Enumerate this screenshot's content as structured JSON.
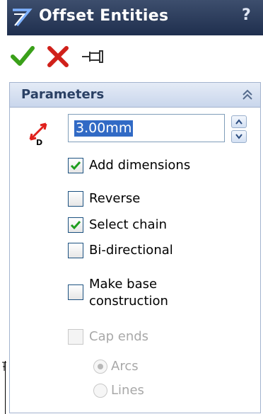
{
  "window": {
    "title": "Offset Entities",
    "help_label": "?",
    "title_icon": "offset-entities-icon"
  },
  "actions": {
    "ok": "checkmark-icon",
    "cancel": "red-x-icon",
    "pin": "push-pin-icon"
  },
  "parameters": {
    "title": "Parameters",
    "collapse_icon": "double-chevron-up-icon",
    "offset_distance": "3.00mm",
    "add_dimensions": {
      "label": "Add dimensions",
      "checked": true
    },
    "reverse": {
      "label": "Reverse",
      "checked": false
    },
    "select_chain": {
      "label": "Select chain",
      "checked": true
    },
    "bi_directional": {
      "label": "Bi-directional",
      "checked": false
    },
    "make_base_construction": {
      "label_line1": "Make base",
      "label_line2": "construction",
      "checked": false
    },
    "cap_ends": {
      "label": "Cap ends",
      "checked": false,
      "enabled": false
    },
    "cap_options": [
      {
        "label": "Arcs",
        "selected": true,
        "enabled": false
      },
      {
        "label": "Lines",
        "selected": false,
        "enabled": false
      }
    ]
  },
  "colors": {
    "title_bar": "#2b3b5a",
    "panel_header": "#d6e0f0",
    "ok_green": "#3aa019",
    "cancel_red": "#d0201a",
    "dimension_red": "#e0201c",
    "selection_blue": "#316ac5",
    "check_green": "#1e9d1e"
  }
}
